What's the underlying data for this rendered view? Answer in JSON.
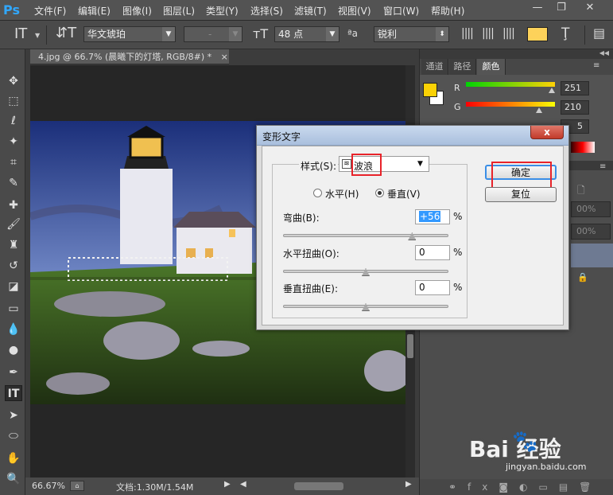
{
  "menubar": {
    "logo": "Ps",
    "items": [
      "文件(F)",
      "编辑(E)",
      "图像(I)",
      "图层(L)",
      "类型(Y)",
      "选择(S)",
      "滤镜(T)",
      "视图(V)",
      "窗口(W)",
      "帮助(H)"
    ],
    "minimize": "—",
    "restore": "❐",
    "close": "✕"
  },
  "options": {
    "font_family": "华文琥珀",
    "font_style": "-",
    "font_size": "48 点",
    "aa_label": "ªa",
    "antialias": "锐利",
    "text_color": "#fdd25a"
  },
  "document": {
    "tab_title": "4.jpg @ 66.7% (晨曦下的灯塔, RGB/8#) *",
    "tab_close": "×"
  },
  "status": {
    "zoom": "66.67%",
    "doc_info": "文档:1.30M/1.54M"
  },
  "panels": {
    "tabs": [
      "通道",
      "路径",
      "颜色"
    ],
    "r_label": "R",
    "r_value": "251",
    "g_label": "G",
    "g_value": "210",
    "b_value": "5",
    "fg_color": "#fbd205",
    "pct1": "00%",
    "pct2": "00%"
  },
  "dialog": {
    "title": "变形文字",
    "close": "x",
    "style_label": "样式(S):",
    "style_value": "波浪",
    "horizontal_label": "水平(H)",
    "vertical_label": "垂直(V)",
    "orientation_selected": "vertical",
    "bend_label": "弯曲(B):",
    "bend_value": "+56",
    "hdistort_label": "水平扭曲(O):",
    "hdistort_value": "0",
    "vdistort_label": "垂直扭曲(E):",
    "vdistort_value": "0",
    "percent": "%",
    "ok_label": "确定",
    "reset_label": "复位",
    "bend_level": 0.78,
    "hdistort_level": 0.5,
    "vdistort_level": 0.5
  },
  "watermark": {
    "brand": "Bai  经验",
    "url": "jingyan.baidu.com"
  }
}
